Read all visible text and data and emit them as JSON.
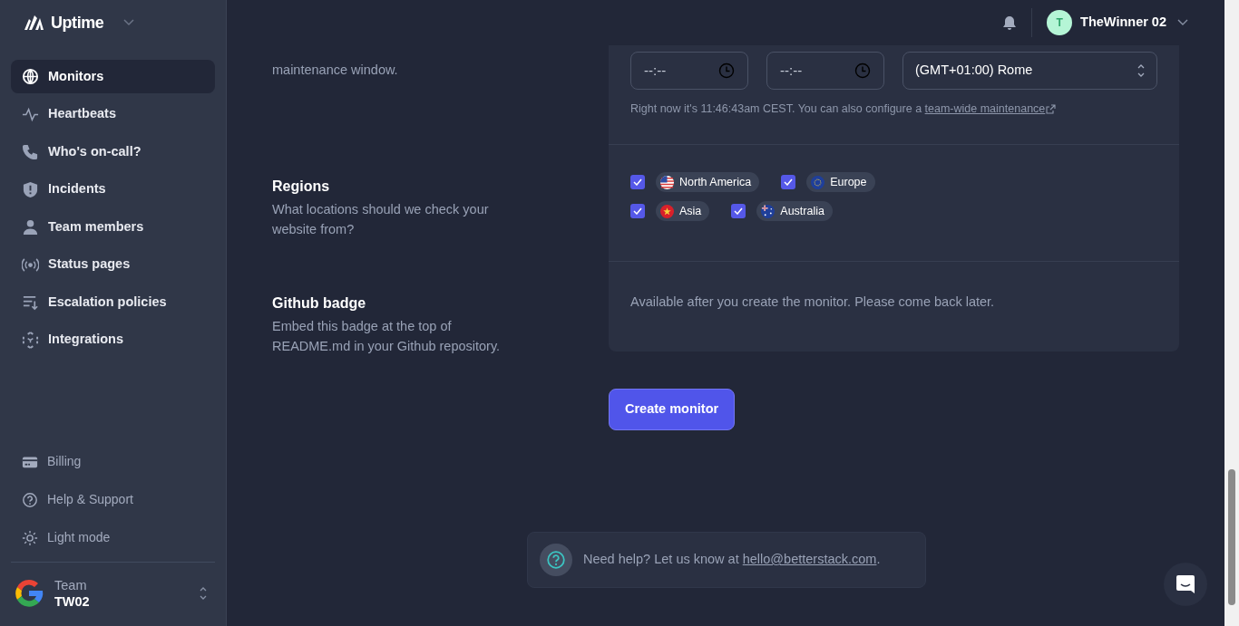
{
  "sidebar": {
    "brand": "Uptime",
    "items": [
      {
        "label": "Monitors",
        "selected": true
      },
      {
        "label": "Heartbeats",
        "selected": false
      },
      {
        "label": "Who's on-call?",
        "selected": false
      },
      {
        "label": "Incidents",
        "selected": false
      },
      {
        "label": "Team members",
        "selected": false
      },
      {
        "label": "Status pages",
        "selected": false
      },
      {
        "label": "Escalation policies",
        "selected": false
      },
      {
        "label": "Integrations",
        "selected": false
      }
    ],
    "footer_items": [
      {
        "label": "Billing"
      },
      {
        "label": "Help & Support"
      },
      {
        "label": "Light mode"
      }
    ],
    "team": {
      "label": "Team",
      "name": "TW02"
    }
  },
  "header": {
    "user": {
      "initial": "T",
      "name": "TheWinner 02"
    }
  },
  "sections": [
    {
      "kind": "maintenance",
      "description": "maintenance window.",
      "time_from": {
        "placeholder": "--:--"
      },
      "time_to": {
        "placeholder": "--:--"
      },
      "timezone": "(GMT+01:00) Rome",
      "note": "Right now it's 11:46:43am CEST. You can also configure a",
      "link": "team-wide maintenance"
    },
    {
      "kind": "regions",
      "title": "Regions",
      "description": "What locations should we check your website from?",
      "regions": [
        {
          "label": "North America",
          "checked": true
        },
        {
          "label": "Europe",
          "checked": true
        },
        {
          "label": "Asia",
          "checked": true
        },
        {
          "label": "Australia",
          "checked": true
        }
      ]
    },
    {
      "kind": "badge",
      "title": "Github badge",
      "description": "Embed this badge at the top of README.md in your Github repository.",
      "note": "Available after you create the monitor. Please come back later."
    }
  ],
  "submit": "Create monitor",
  "help": {
    "text": "Need help? Let us know at",
    "email": "hello@betterstack.com",
    "suffix": "."
  }
}
